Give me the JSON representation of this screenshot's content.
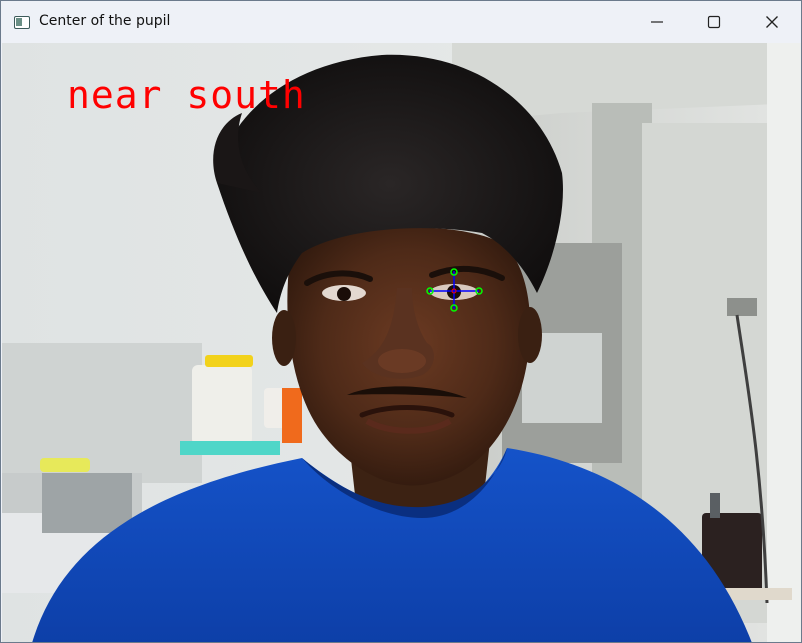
{
  "window": {
    "title": "Center of the pupil"
  },
  "overlay": {
    "direction_label": "near south"
  },
  "icons": {
    "app": "app-window-icon",
    "minimize": "minimize-icon",
    "maximize": "maximize-icon",
    "close": "close-icon"
  },
  "colors": {
    "overlay_text": "#ff0000",
    "pupil_marker_ring": "#00ff00",
    "pupil_marker_cross": "#0000ff",
    "titlebar": "#eef1f7"
  }
}
